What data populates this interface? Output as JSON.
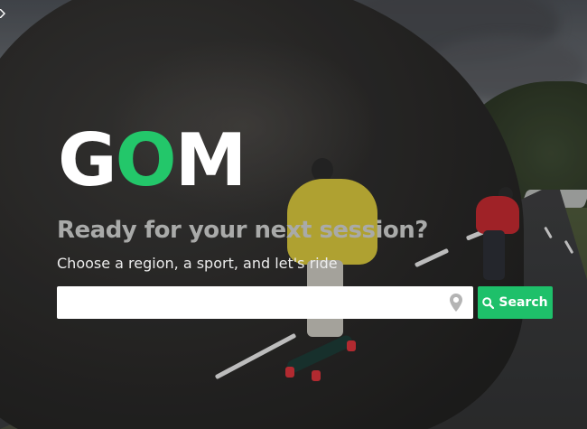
{
  "brand": {
    "logo_prefix": "G",
    "logo_accent": "O",
    "logo_suffix": "M",
    "accent_color": "#23c76a"
  },
  "hero": {
    "headline": "Ready for your next session?",
    "subline": "Choose a region, a sport, and let's ride",
    "background_image": "longboarders-on-mountain-road"
  },
  "search": {
    "input_value": "",
    "location_icon": "map-pin-icon",
    "button_icon": "search-icon",
    "button_label": "Search",
    "button_color": "#1ec06a"
  }
}
